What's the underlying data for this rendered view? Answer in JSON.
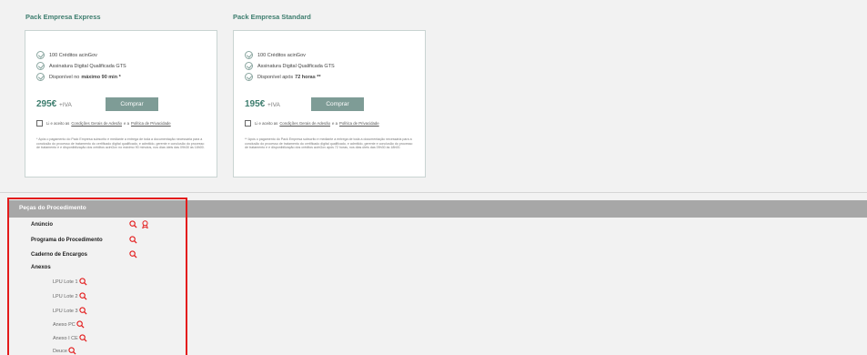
{
  "packs": [
    {
      "title": "Pack Empresa Express",
      "features": [
        "100 Créditos acinGov",
        "Assinatura Digital Qualificada GTS",
        "Disponível no "
      ],
      "feature3_strong": "máximo 90 min *",
      "price": "295€",
      "iva": "+IVA",
      "buy_label": "Comprar",
      "terms_prefix": "Li e aceito as",
      "terms_link1": "Condições Gerais de Adesão",
      "terms_mid": "e a",
      "terms_link2": "Política de Privacidade",
      "note": "* Após o pagamento do Pack Empresa subscrito e mediante a entrega de toda a documentação necessária para a conclusão do processo de tratamento do certificado digital qualificado, e admitido, gerente e conclusão do processo de tratamento e e disponibilização dos créditos acinGov no máximo 90 minutos, nos dias úteis das 09h30 às 18h00."
    },
    {
      "title": "Pack Empresa Standard",
      "features": [
        "100 Créditos acinGov",
        "Assinatura Digital Qualificada GTS",
        "Disponível após "
      ],
      "feature3_strong": "72 horas **",
      "price": "195€",
      "iva": "+IVA",
      "buy_label": "Comprar",
      "terms_prefix": "Li e aceito as",
      "terms_link1": "Condições Gerais de Adesão",
      "terms_mid": "e a",
      "terms_link2": "Política de Privacidade",
      "note": "** Após o pagamento do Pack Empresa subscrito e mediante a entrega de toda a documentação necessária para a conclusão do processo de tratamento do certificado digital qualificado, e admitido, gerente e conclusão do processo de tratamento e e disponibilização dos créditos acinGov após 72 horas, nos dias úteis das 09h30 às 18h00."
    }
  ],
  "pecas": {
    "title": "Peças do Procedimento",
    "items": [
      "Anúncio",
      "Programa do Procedimento",
      "Caderno de Encargos",
      "Anexos"
    ],
    "anexos": [
      "LPU Lote 1",
      "LPU Lote 2",
      "LPU Lote 3",
      "Anexo PC",
      "Anexo I CE",
      "Deuce"
    ]
  },
  "colors": {
    "accent": "#3d7d6e",
    "highlight": "#e31b1b",
    "button": "#7e9c96"
  },
  "icons": {
    "view": "magnifier-icon",
    "certificate": "award-icon",
    "check": "check-circle-icon"
  }
}
